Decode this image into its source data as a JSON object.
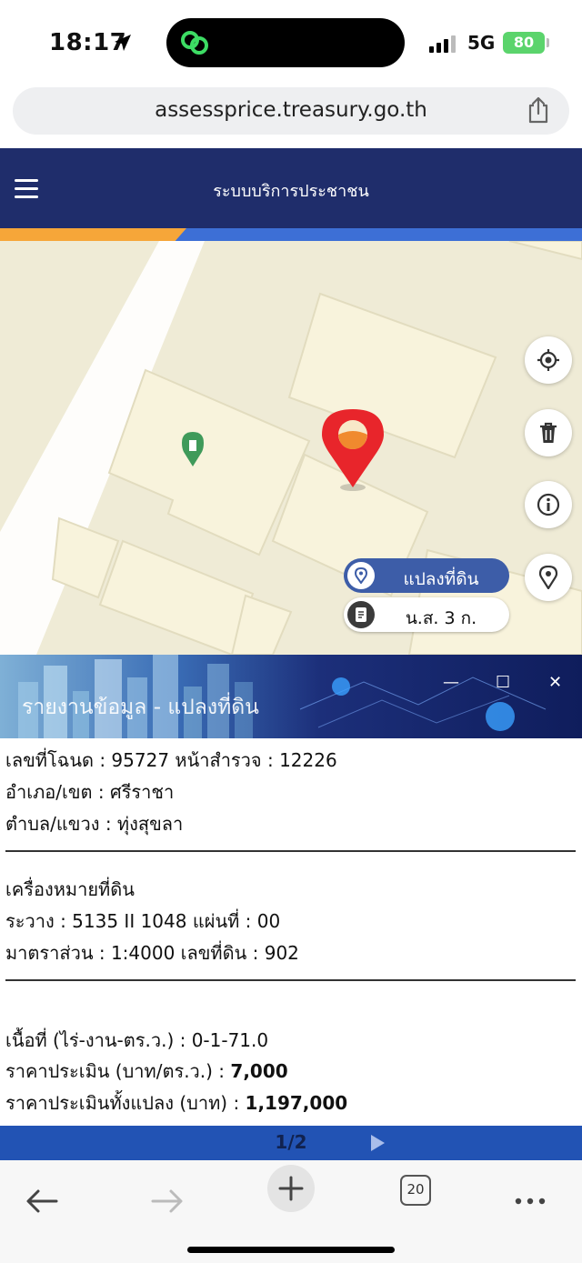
{
  "status_bar": {
    "time": "18:17",
    "network": "5G",
    "battery": "80"
  },
  "browser": {
    "url": "assessprice.treasury.go.th",
    "tab_count": "20"
  },
  "app": {
    "title": "ระบบบริการประชาชน"
  },
  "map": {
    "layers": [
      {
        "label": "แปลงที่ดิน",
        "icon": "map-pin-icon",
        "active": true
      },
      {
        "label": "น.ส. 3 ก.",
        "icon": "document-icon",
        "active": false
      }
    ],
    "tools": [
      "locate-icon",
      "trash-icon",
      "info-icon",
      "pin-icon"
    ]
  },
  "panel": {
    "title": "รายงานข้อมูล - แปลงที่ดิน",
    "deed_line": "เลขที่โฉนด : 95727 หน้าสำรวจ : 12226",
    "district_line": "อำเภอ/เขต : ศรีราชา",
    "subdistrict_line": "ตำบล/แขวง : ทุ่งสุขลา",
    "mark_heading": "เครื่องหมายที่ดิน",
    "survey_line": "ระวาง : 5135 II 1048 แผ่นที่ : 00",
    "scale_line": "มาตราส่วน : 1:4000 เลขที่ดิน : 902",
    "area_line": "เนื้อที่ (ไร่-งาน-ตร.ว.) : 0-1-71.0",
    "price_label": "ราคาประเมิน (บาท/ตร.ว.) : ",
    "price_value": "7,000",
    "total_label": "ราคาประเมินทั้งแปลง (บาท) : ",
    "total_value": "1,197,000",
    "pager": "1/2"
  },
  "colors": {
    "header_navy": "#1f2d6b",
    "accent_orange": "#f6a639",
    "accent_blue": "#3d6fd6",
    "pin_red": "#e8252b",
    "pager_blue": "#2253b4"
  }
}
